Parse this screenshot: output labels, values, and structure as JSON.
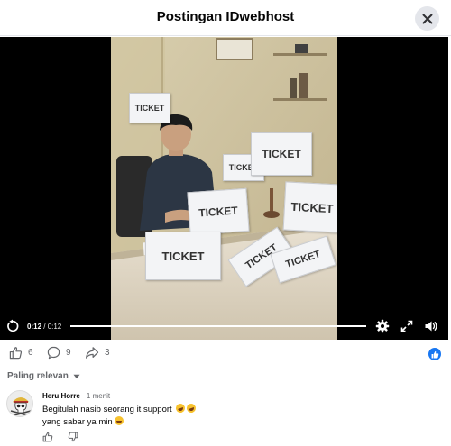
{
  "header": {
    "title": "Postingan IDwebhost",
    "close_icon": "close-icon"
  },
  "video": {
    "scene_tickets": [
      "TICKET",
      "TICKET",
      "TICKET",
      "TICKET",
      "TICKET",
      "TICKET",
      "TICKET",
      "TICKET"
    ],
    "current_time": "0:12",
    "separator": " / ",
    "duration": "0:12",
    "progress": 1.0,
    "icons": [
      "replay-icon",
      "settings-gear-icon",
      "fullscreen-icon",
      "volume-icon"
    ]
  },
  "actions": {
    "likes": "6",
    "comments": "9",
    "shares": "3",
    "icons": [
      "like-icon",
      "comment-icon",
      "share-icon",
      "like-reaction-icon"
    ]
  },
  "sort": {
    "label": "Paling relevan"
  },
  "comments": [
    {
      "author": "Heru Horre",
      "time": " · 1 menit",
      "line1": "Begitulah nasib seorang it support ",
      "line2": "yang sabar ya min"
    }
  ],
  "colors": {
    "accent": "#1877f2",
    "muted": "#65676b",
    "divider": "#e4e6eb"
  }
}
